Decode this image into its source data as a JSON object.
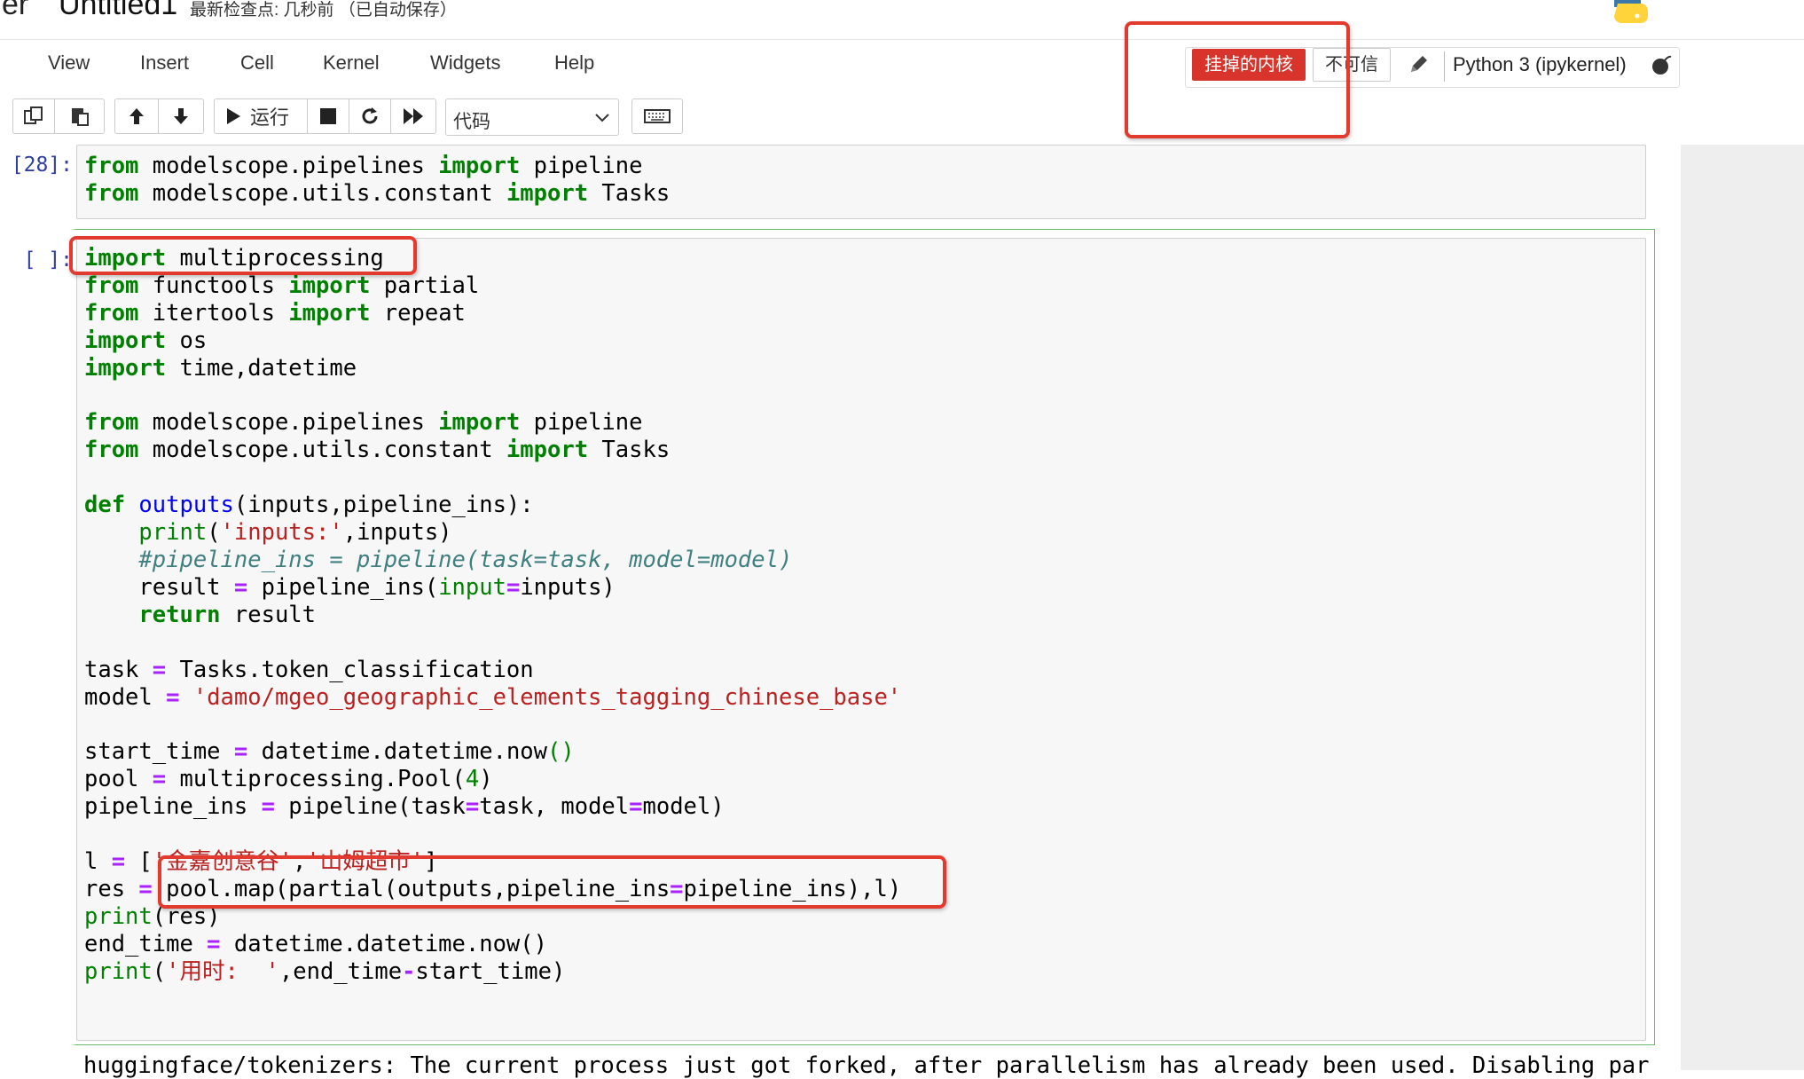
{
  "header": {
    "logo_text": "er",
    "notebook_title": "Untitled1",
    "checkpoint_text": "最新检查点: 几秒前  （已自动保存）",
    "logo_icon": "python-logo-icon"
  },
  "menubar": {
    "items": [
      "View",
      "Insert",
      "Cell",
      "Kernel",
      "Widgets",
      "Help"
    ]
  },
  "kernel_status": {
    "dead_label": "挂掉的内核",
    "trust_label": "不可信",
    "edit_icon": "pencil-icon",
    "kernel_name": "Python 3 (ipykernel)",
    "indicator_icon": "kernel-bomb-icon",
    "dead_color": "#d9342b"
  },
  "toolbar": {
    "run_label": "运行",
    "cell_type_value": "代码",
    "icons": [
      "copy-icon",
      "paste-icon",
      "move-up-icon",
      "move-down-icon",
      "run-icon",
      "stop-icon",
      "restart-icon",
      "fast-forward-icon",
      "keyboard-icon"
    ]
  },
  "cells": [
    {
      "prompt": "[28]:",
      "lines": [
        "from modelscope.pipelines import pipeline",
        "from modelscope.utils.constant import Tasks"
      ]
    },
    {
      "prompt": "[ ]:",
      "lines": [
        "import multiprocessing",
        "from functools import partial",
        "from itertools import repeat",
        "import os",
        "import time,datetime",
        "",
        "from modelscope.pipelines import pipeline",
        "from modelscope.utils.constant import Tasks",
        "",
        "def outputs(inputs,pipeline_ins):",
        "    print('inputs:',inputs)",
        "    #pipeline_ins = pipeline(task=task, model=model)",
        "    result = pipeline_ins(input=inputs)",
        "    return result",
        "",
        "task = Tasks.token_classification",
        "model = 'damo/mgeo_geographic_elements_tagging_chinese_base'",
        "",
        "start_time = datetime.datetime.now()",
        "pool = multiprocessing.Pool(4)",
        "pipeline_ins = pipeline(task=task, model=model)",
        "",
        "l = ['金嘉创意谷','山姆超市']",
        "res = pool.map(partial(outputs,pipeline_ins=pipeline_ins),l)",
        "print(res)",
        "end_time = datetime.datetime.now()",
        "print('用时:  ',end_time-start_time)"
      ],
      "output": "huggingface/tokenizers: The current process just got forked, after parallelism has already been used. Disabling par"
    }
  ],
  "annotation_color": "#e23a2e"
}
